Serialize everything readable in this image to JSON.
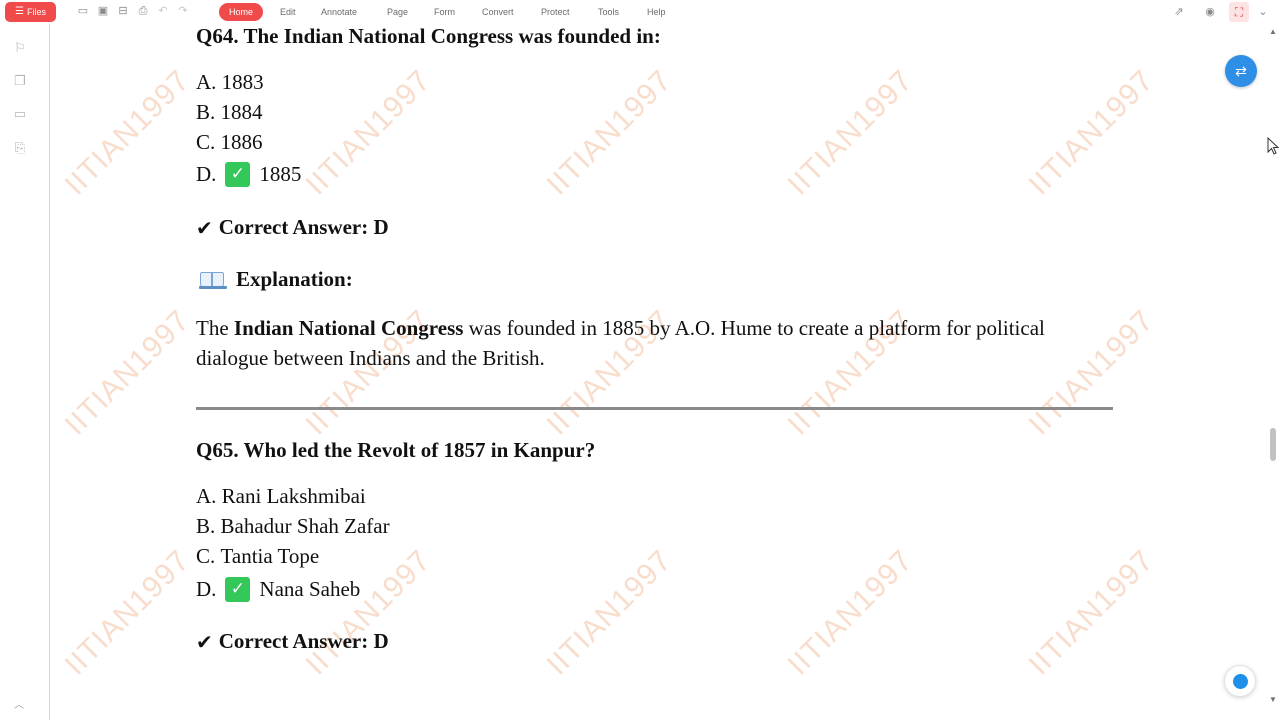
{
  "toolbar": {
    "files_label": "Files",
    "menu_tabs": [
      "Home",
      "Edit",
      "Annotate",
      "Page",
      "Form",
      "Convert",
      "Protect",
      "Tools",
      "Help"
    ],
    "active_tab": "Home",
    "quick_access_icons": [
      "open-icon",
      "save-icon",
      "save-as-icon",
      "print-icon",
      "undo-icon",
      "redo-icon"
    ],
    "right_icons": [
      "share-icon",
      "read-mode-icon",
      "fullscreen-icon",
      "chevron-down-icon"
    ]
  },
  "sidebar": {
    "icons": [
      "bookmark-icon",
      "thumbnails-icon",
      "comments-icon",
      "attachments-icon"
    ],
    "collapse_icon": "chevron-up-icon"
  },
  "document": {
    "watermark_text": "IITIAN1997",
    "q64": {
      "title": "Q64. The Indian National Congress was founded in:",
      "options": [
        {
          "letter": "A.",
          "text": "1883",
          "correct": false
        },
        {
          "letter": "B.",
          "text": "1884",
          "correct": false
        },
        {
          "letter": "C.",
          "text": "1886",
          "correct": false
        },
        {
          "letter": "D.",
          "text": "1885",
          "correct": true
        }
      ],
      "correct_answer": "Correct Answer: D",
      "explanation_heading": "Explanation:",
      "explanation": {
        "pre": "The ",
        "bold": "Indian National Congress",
        "post": " was founded in 1885 by A.O. Hume to create a platform for political dialogue between Indians and the British."
      }
    },
    "q65": {
      "title": "Q65. Who led the Revolt of 1857 in Kanpur?",
      "options": [
        {
          "letter": "A.",
          "text": "Rani Lakshmibai",
          "correct": false
        },
        {
          "letter": "B.",
          "text": "Bahadur Shah Zafar",
          "correct": false
        },
        {
          "letter": "C.",
          "text": "Tantia Tope",
          "correct": false
        },
        {
          "letter": "D.",
          "text": "Nana Saheb",
          "correct": true
        }
      ],
      "correct_answer": "Correct Answer: D"
    },
    "tick_glyph": "✔",
    "check_glyph": "✓"
  },
  "colors": {
    "accent": "#f04a4a",
    "check_green": "#34c759",
    "float_blue": "#2f8ee5",
    "watermark": "#e89664"
  }
}
